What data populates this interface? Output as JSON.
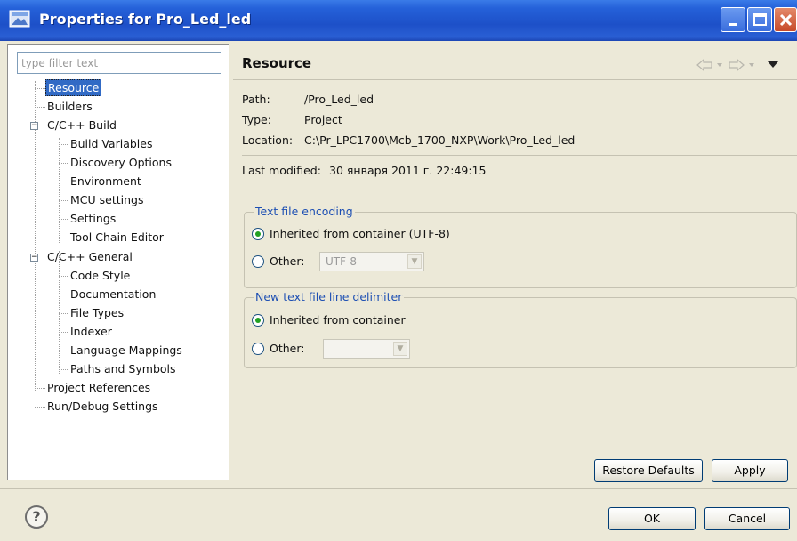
{
  "window": {
    "title": "Properties for Pro_Led_led",
    "colors": {
      "titlebar": "#2561d9",
      "selection": "#316ac5",
      "group_title": "#1d4fb3",
      "radio_dot": "#22a022"
    }
  },
  "filter": {
    "placeholder": "type filter text"
  },
  "tree": {
    "items": [
      {
        "label": "Resource",
        "selected": true
      },
      {
        "label": "Builders"
      },
      {
        "label": "C/C++ Build",
        "expanded": true
      },
      {
        "label": "Build Variables"
      },
      {
        "label": "Discovery Options"
      },
      {
        "label": "Environment"
      },
      {
        "label": "MCU settings"
      },
      {
        "label": "Settings"
      },
      {
        "label": "Tool Chain Editor"
      },
      {
        "label": "C/C++ General",
        "expanded": true
      },
      {
        "label": "Code Style"
      },
      {
        "label": "Documentation"
      },
      {
        "label": "File Types"
      },
      {
        "label": "Indexer"
      },
      {
        "label": "Language Mappings"
      },
      {
        "label": "Paths and Symbols"
      },
      {
        "label": "Project References"
      },
      {
        "label": "Run/Debug Settings"
      }
    ]
  },
  "page": {
    "title": "Resource",
    "nav_icons": [
      "back-arrow-icon",
      "forward-arrow-icon",
      "view-menu-icon"
    ],
    "path": {
      "label": "Path:",
      "value": "/Pro_Led_led"
    },
    "type": {
      "label": "Type:",
      "value": "Project"
    },
    "location": {
      "label": "Location:",
      "value": "C:\\Pr_LPC1700\\Mcb_1700_NXP\\Work\\Pro_Led_led"
    },
    "last_modified": {
      "label": "Last modified:",
      "value": "30 января 2011 г. 22:49:15"
    }
  },
  "encoding": {
    "title": "Text file encoding",
    "inherited_label": "Inherited from container (UTF-8)",
    "other_label": "Other:",
    "other_value": "UTF-8",
    "selected": "inherited"
  },
  "delimiter": {
    "title": "New text file line delimiter",
    "inherited_label": "Inherited from container",
    "other_label": "Other:",
    "other_value": "",
    "selected": "inherited"
  },
  "buttons": {
    "restore_defaults": "Restore Defaults",
    "apply": "Apply",
    "ok": "OK",
    "cancel": "Cancel"
  }
}
